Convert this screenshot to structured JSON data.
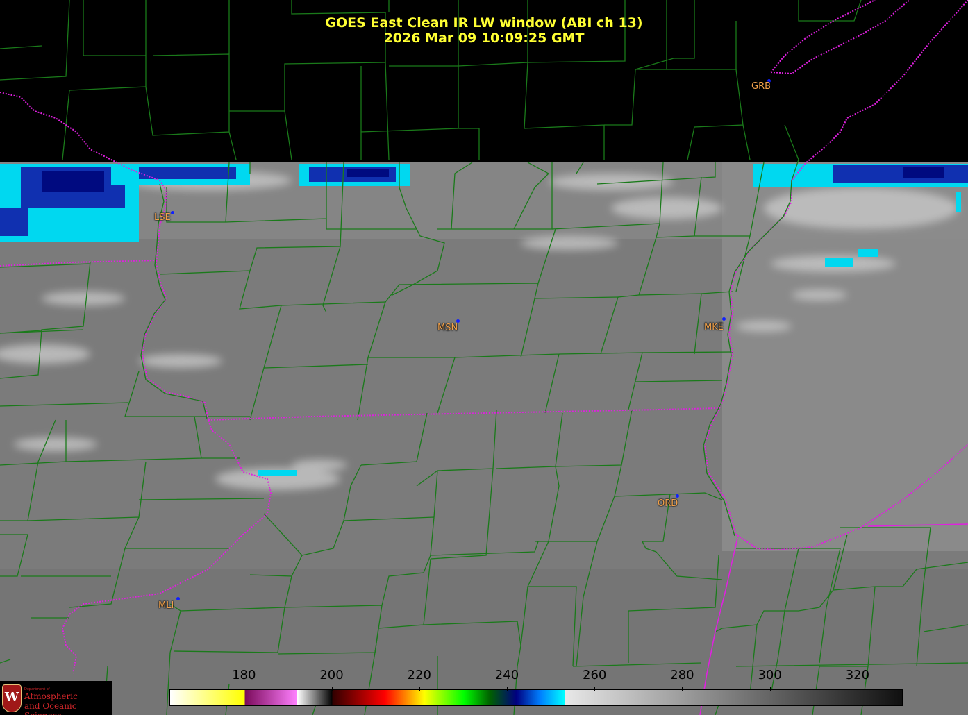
{
  "title": {
    "line1": "GOES East Clean IR LW window (ABI ch 13)",
    "line2": "2026 Mar 09  10:09:25 GMT"
  },
  "colors": {
    "title_text": "#ffff33",
    "background_no_data": "#000000",
    "county_border": "#1a7a1a",
    "state_border": "#e020e0",
    "station_label": "#f0a04a",
    "station_dot": "#1020ff",
    "cloud_cold": "#00e5ff",
    "cloud_coldest": "#000a80"
  },
  "stations": [
    {
      "id": "GRB"
    },
    {
      "id": "LSE"
    },
    {
      "id": "MSN"
    },
    {
      "id": "MKE"
    },
    {
      "id": "ORD"
    },
    {
      "id": "MLI"
    }
  ],
  "colorbar": {
    "ticks": [
      "180",
      "200",
      "220",
      "240",
      "260",
      "280",
      "300",
      "320"
    ],
    "range_min": 163,
    "range_max": 330,
    "segments": [
      {
        "from": 163,
        "to": 180,
        "colors": [
          "#ffffff",
          "#ffff00"
        ]
      },
      {
        "from": 180,
        "to": 192,
        "colors": [
          "#7a0a5a",
          "#ff80ff"
        ]
      },
      {
        "from": 192,
        "to": 200,
        "colors": [
          "#ffffff",
          "#000000"
        ]
      },
      {
        "from": 200,
        "to": 212,
        "colors": [
          "#300000",
          "#ff0000"
        ]
      },
      {
        "from": 212,
        "to": 230,
        "colors": [
          "#ff0000",
          "#ffff00",
          "#00ff00"
        ]
      },
      {
        "from": 230,
        "to": 242,
        "colors": [
          "#00ff00",
          "#006000",
          "#000080"
        ]
      },
      {
        "from": 242,
        "to": 253,
        "colors": [
          "#000080",
          "#0080ff",
          "#00ffff"
        ]
      },
      {
        "from": 253,
        "to": 330,
        "colors": [
          "#e8e8e8",
          "#101010"
        ]
      }
    ]
  },
  "logo": {
    "department": "Department of",
    "line1": "Atmospheric",
    "line2": "and Oceanic Sciences",
    "crest_letter": "W"
  }
}
